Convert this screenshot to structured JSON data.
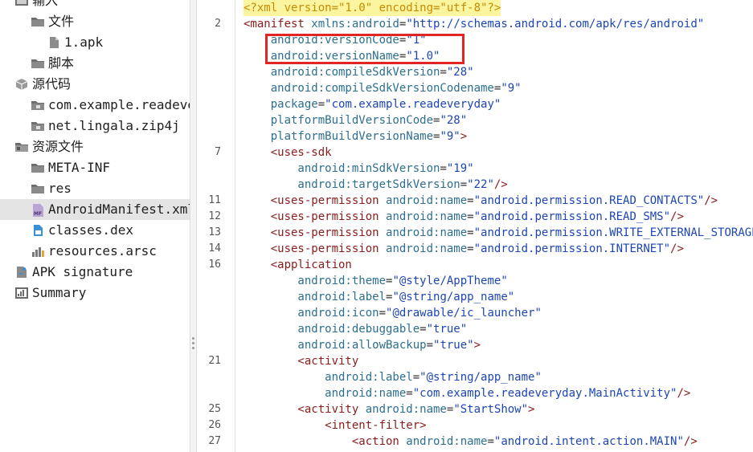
{
  "tree": {
    "items": [
      {
        "label": "输入",
        "indent": 1,
        "arrow": "⌄",
        "icon": "input-icon"
      },
      {
        "label": "文件",
        "indent": 2,
        "arrow": "⌄",
        "icon": "folder-icon"
      },
      {
        "label": "1.apk",
        "indent": 3,
        "arrow": "",
        "icon": "file-icon"
      },
      {
        "label": "脚本",
        "indent": 2,
        "arrow": "",
        "icon": "folder-icon"
      },
      {
        "label": "源代码",
        "indent": 1,
        "arrow": "⌄",
        "icon": "package-icon"
      },
      {
        "label": "com.example.readeveryday",
        "indent": 2,
        "arrow": "›",
        "icon": "package-folder-icon"
      },
      {
        "label": "net.lingala.zip4j",
        "indent": 2,
        "arrow": "›",
        "icon": "package-folder-icon"
      },
      {
        "label": "资源文件",
        "indent": 1,
        "arrow": "⌄",
        "icon": "resources-icon"
      },
      {
        "label": "META-INF",
        "indent": 2,
        "arrow": "›",
        "icon": "folder-icon"
      },
      {
        "label": "res",
        "indent": 2,
        "arrow": "›",
        "icon": "folder-icon"
      },
      {
        "label": "AndroidManifest.xml",
        "indent": 2,
        "arrow": "",
        "icon": "manifest-file-icon",
        "selected": true
      },
      {
        "label": "classes.dex",
        "indent": 2,
        "arrow": "",
        "icon": "dex-file-icon"
      },
      {
        "label": "resources.arsc",
        "indent": 2,
        "arrow": "›",
        "icon": "arsc-file-icon"
      },
      {
        "label": "APK signature",
        "indent": 1,
        "arrow": "",
        "icon": "signature-icon"
      },
      {
        "label": "Summary",
        "indent": 1,
        "arrow": "",
        "icon": "summary-icon"
      }
    ]
  },
  "editor": {
    "line_numbers": [
      "",
      "2",
      "",
      "",
      "",
      "",
      "",
      "",
      "",
      "7",
      "",
      "",
      "11",
      "12",
      "13",
      "14",
      "16",
      "",
      "",
      "",
      "",
      "",
      "21",
      "",
      "",
      "25",
      "26",
      "27"
    ],
    "lines": [
      [
        {
          "t": "<?xml version=\"1.0\" encoding=\"utf-8\"?>",
          "c": "pi"
        }
      ],
      [
        {
          "t": "<manifest ",
          "c": "tag"
        },
        {
          "t": "xmlns:android",
          "c": "attr"
        },
        {
          "t": "=",
          "c": "punct"
        },
        {
          "t": "\"http://schemas.android.com/apk/res/android\"",
          "c": "val"
        }
      ],
      [
        {
          "t": "    android:versionCode",
          "c": "attr"
        },
        {
          "t": "=",
          "c": "punct"
        },
        {
          "t": "\"1\"",
          "c": "val"
        }
      ],
      [
        {
          "t": "    android:versionName",
          "c": "attr"
        },
        {
          "t": "=",
          "c": "punct"
        },
        {
          "t": "\"1.0\"",
          "c": "val"
        }
      ],
      [
        {
          "t": "    android:compileSdkVersion",
          "c": "attr"
        },
        {
          "t": "=",
          "c": "punct"
        },
        {
          "t": "\"28\"",
          "c": "val"
        }
      ],
      [
        {
          "t": "    android:compileSdkVersionCodename",
          "c": "attr"
        },
        {
          "t": "=",
          "c": "punct"
        },
        {
          "t": "\"9\"",
          "c": "val"
        }
      ],
      [
        {
          "t": "    package",
          "c": "attr"
        },
        {
          "t": "=",
          "c": "punct"
        },
        {
          "t": "\"com.example.readeveryday\"",
          "c": "val"
        }
      ],
      [
        {
          "t": "    platformBuildVersionCode",
          "c": "attr"
        },
        {
          "t": "=",
          "c": "punct"
        },
        {
          "t": "\"28\"",
          "c": "val"
        }
      ],
      [
        {
          "t": "    platformBuildVersionName",
          "c": "attr"
        },
        {
          "t": "=",
          "c": "punct"
        },
        {
          "t": "\"9\"",
          "c": "val"
        },
        {
          "t": ">",
          "c": "tag"
        }
      ],
      [
        {
          "t": "    <uses-sdk",
          "c": "tag"
        }
      ],
      [
        {
          "t": "        android:minSdkVersion",
          "c": "attr"
        },
        {
          "t": "=",
          "c": "punct"
        },
        {
          "t": "\"19\"",
          "c": "val"
        }
      ],
      [
        {
          "t": "        android:targetSdkVersion",
          "c": "attr"
        },
        {
          "t": "=",
          "c": "punct"
        },
        {
          "t": "\"22\"",
          "c": "val"
        },
        {
          "t": "/>",
          "c": "tag"
        }
      ],
      [
        {
          "t": "    <uses-permission ",
          "c": "tag"
        },
        {
          "t": "android:name",
          "c": "attr"
        },
        {
          "t": "=",
          "c": "punct"
        },
        {
          "t": "\"android.permission.READ_CONTACTS\"",
          "c": "val"
        },
        {
          "t": "/>",
          "c": "tag"
        }
      ],
      [
        {
          "t": "    <uses-permission ",
          "c": "tag"
        },
        {
          "t": "android:name",
          "c": "attr"
        },
        {
          "t": "=",
          "c": "punct"
        },
        {
          "t": "\"android.permission.READ_SMS\"",
          "c": "val"
        },
        {
          "t": "/>",
          "c": "tag"
        }
      ],
      [
        {
          "t": "    <uses-permission ",
          "c": "tag"
        },
        {
          "t": "android:name",
          "c": "attr"
        },
        {
          "t": "=",
          "c": "punct"
        },
        {
          "t": "\"android.permission.WRITE_EXTERNAL_STORAGE\"",
          "c": "val"
        },
        {
          "t": "/>",
          "c": "tag"
        }
      ],
      [
        {
          "t": "    <uses-permission ",
          "c": "tag"
        },
        {
          "t": "android:name",
          "c": "attr"
        },
        {
          "t": "=",
          "c": "punct"
        },
        {
          "t": "\"android.permission.INTERNET\"",
          "c": "val"
        },
        {
          "t": "/>",
          "c": "tag"
        }
      ],
      [
        {
          "t": "    <application",
          "c": "tag"
        }
      ],
      [
        {
          "t": "        android:theme",
          "c": "attr"
        },
        {
          "t": "=",
          "c": "punct"
        },
        {
          "t": "\"@style/AppTheme\"",
          "c": "val"
        }
      ],
      [
        {
          "t": "        android:label",
          "c": "attr"
        },
        {
          "t": "=",
          "c": "punct"
        },
        {
          "t": "\"@string/app_name\"",
          "c": "val"
        }
      ],
      [
        {
          "t": "        android:icon",
          "c": "attr"
        },
        {
          "t": "=",
          "c": "punct"
        },
        {
          "t": "\"@drawable/ic_launcher\"",
          "c": "val"
        }
      ],
      [
        {
          "t": "        android:debuggable",
          "c": "attr"
        },
        {
          "t": "=",
          "c": "punct"
        },
        {
          "t": "\"true\"",
          "c": "val"
        }
      ],
      [
        {
          "t": "        android:allowBackup",
          "c": "attr"
        },
        {
          "t": "=",
          "c": "punct"
        },
        {
          "t": "\"true\"",
          "c": "val"
        },
        {
          "t": ">",
          "c": "tag"
        }
      ],
      [
        {
          "t": "        <activity",
          "c": "tag"
        }
      ],
      [
        {
          "t": "            android:label",
          "c": "attr"
        },
        {
          "t": "=",
          "c": "punct"
        },
        {
          "t": "\"@string/app_name\"",
          "c": "val"
        }
      ],
      [
        {
          "t": "            android:name",
          "c": "attr"
        },
        {
          "t": "=",
          "c": "punct"
        },
        {
          "t": "\"com.example.readeveryday.MainActivity\"",
          "c": "val"
        },
        {
          "t": "/>",
          "c": "tag"
        }
      ],
      [
        {
          "t": "        <activity ",
          "c": "tag"
        },
        {
          "t": "android:name",
          "c": "attr"
        },
        {
          "t": "=",
          "c": "punct"
        },
        {
          "t": "\"StartShow\"",
          "c": "val"
        },
        {
          "t": ">",
          "c": "tag"
        }
      ],
      [
        {
          "t": "            <intent-filter",
          "c": "tag"
        },
        {
          "t": ">",
          "c": "tag"
        }
      ],
      [
        {
          "t": "                <action ",
          "c": "tag"
        },
        {
          "t": "android:name",
          "c": "attr"
        },
        {
          "t": "=",
          "c": "punct"
        },
        {
          "t": "\"android.intent.action.MAIN\"",
          "c": "val"
        },
        {
          "t": "/>",
          "c": "tag"
        }
      ]
    ]
  },
  "colors": {
    "highlight_line": "#fbf5a0",
    "highlight_box": "#e32424",
    "selected_row": "#e4e4e4"
  }
}
